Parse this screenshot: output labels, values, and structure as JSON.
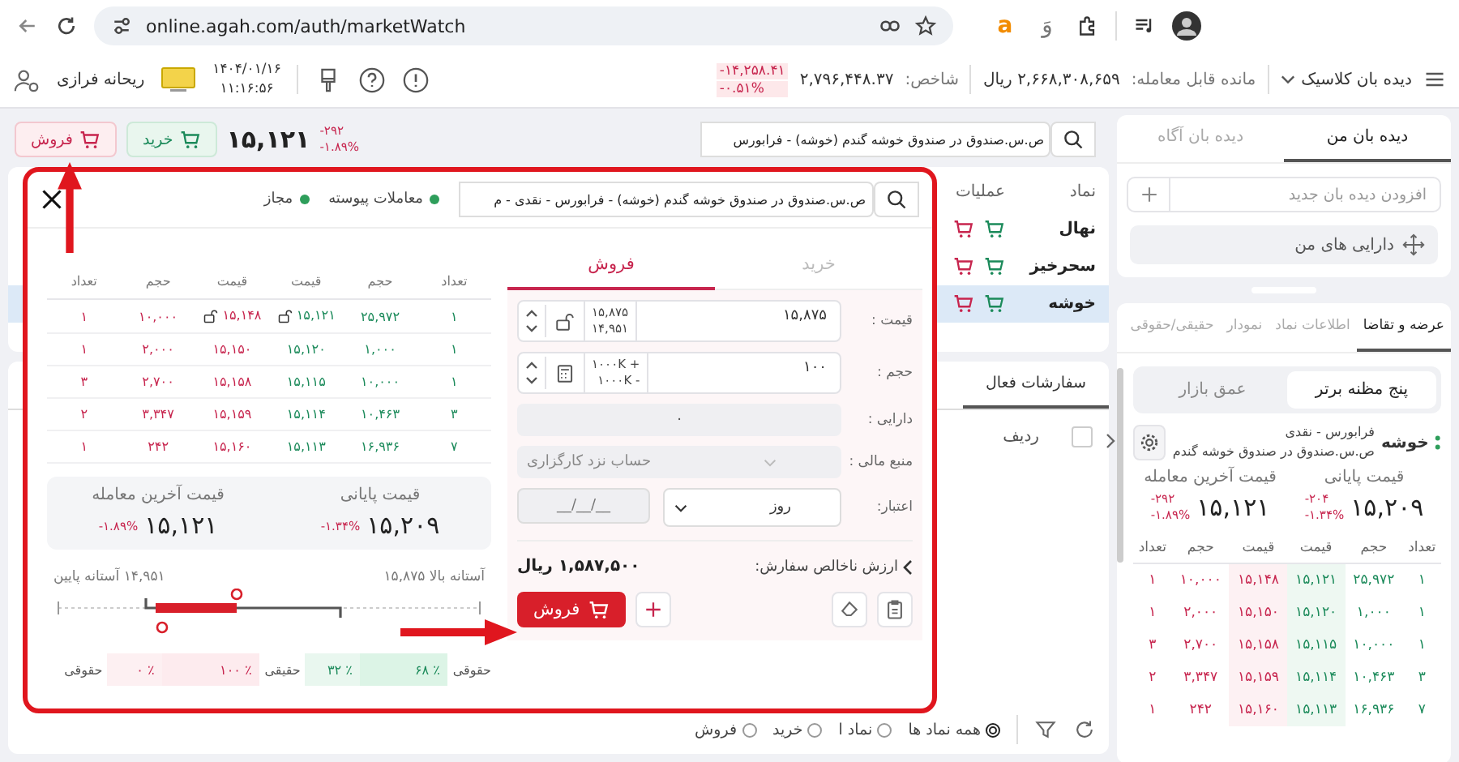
{
  "browser": {
    "url": "online.agah.com/auth/marketWatch",
    "extension_glyphs": {
      "left": "a",
      "right": "وَ"
    }
  },
  "header": {
    "menu_title": "دیده بان کلاسیک",
    "balance_label": "مانده قابل معامله:",
    "balance_value": "۲,۶۶۸,۳۰۸,۶۵۹ ریال",
    "index_label": "شاخص:",
    "index_value": "۲,۷۹۶,۴۴۸.۳۷",
    "index_change": "-۱۴,۲۵۸.۴۱",
    "index_percent": "-۰.۵۱%",
    "date": "۱۴۰۴/۰۱/۱۶",
    "time": "۱۱:۱۶:۵۶",
    "user": "ریحانه فرازی"
  },
  "symbol_bar": {
    "search_value": "ص.س.صندوق در صندوق خوشه گندم (خوشه) - فرابورس",
    "change": "-۲۹۲",
    "percent": "-۱.۸۹%",
    "price": "۱۵,۱۲۱",
    "buy_label": "خرید",
    "sell_label": "فروش"
  },
  "watchlist": {
    "columns": [
      "نماد",
      "عملیات"
    ],
    "rows": [
      {
        "symbol": "نهال",
        "selected": false
      },
      {
        "symbol": "سحرخیز",
        "selected": false
      },
      {
        "symbol": "خوشه",
        "selected": true
      }
    ]
  },
  "orders": {
    "tab": "سفارشات فعال",
    "column": "ردیف",
    "checked": false,
    "filters": [
      {
        "label": "همه نماد ها",
        "selected": true
      },
      {
        "label": "نماد ا",
        "selected": false
      },
      {
        "label": "خرید",
        "selected": false
      },
      {
        "label": "فروش",
        "selected": false
      }
    ]
  },
  "sidebar": {
    "watch_tabs": [
      {
        "label": "دیده بان من",
        "selected": true
      },
      {
        "label": "دیده بان آگاه",
        "selected": false
      }
    ],
    "new_watch_placeholder": "افزودن دیده بان جدید",
    "my_assets": "دارایی های من",
    "info_tabs": [
      {
        "label": "عرضه و تقاضا",
        "selected": true
      },
      {
        "label": "اطلاعات نماد",
        "selected": false
      },
      {
        "label": "نمودار",
        "selected": false
      },
      {
        "label": "حقیقی/حقوقی",
        "selected": false
      }
    ],
    "depth_tabs": [
      {
        "label": "پنج مظنه برتر",
        "selected": true
      },
      {
        "label": "عمق بازار",
        "selected": false
      }
    ],
    "symbol": {
      "name": "خوشه",
      "market": "فرابورس - نقدی",
      "full_name": "ص.س.صندوق در صندوق خوشه گندم"
    },
    "prices": [
      {
        "label": "قیمت پایانی",
        "value": "۱۵,۲۰۹",
        "change": "-۲۰۴",
        "percent": "-۱.۳۴%"
      },
      {
        "label": "قیمت آخرین معامله",
        "value": "۱۵,۱۲۱",
        "change": "-۲۹۲",
        "percent": "-۱.۸۹%"
      }
    ],
    "book": {
      "columns": [
        "تعداد",
        "حجم",
        "قیمت",
        "قیمت",
        "حجم",
        "تعداد"
      ],
      "rows": [
        [
          "۱",
          "۲۵,۹۷۲",
          "۱۵,۱۲۱",
          "۱۵,۱۴۸",
          "۱۰,۰۰۰",
          "۱"
        ],
        [
          "۱",
          "۱,۰۰۰",
          "۱۵,۱۲۰",
          "۱۵,۱۵۰",
          "۲,۰۰۰",
          "۱"
        ],
        [
          "۱",
          "۱۰,۰۰۰",
          "۱۵,۱۱۵",
          "۱۵,۱۵۸",
          "۲,۷۰۰",
          "۳"
        ],
        [
          "۳",
          "۱۰,۴۶۳",
          "۱۵,۱۱۴",
          "۱۵,۱۵۹",
          "۳,۳۴۷",
          "۲"
        ],
        [
          "۷",
          "۱۶,۹۳۶",
          "۱۵,۱۱۳",
          "۱۵,۱۶۰",
          "۲۴۲",
          "۱"
        ]
      ]
    }
  },
  "order_dialog": {
    "search_value": "ص.س.صندوق در صندوق خوشه گندم (خوشه) - فرابورس - نقدی - م",
    "statuses": [
      {
        "label": "معاملات پیوسته",
        "color": "#2e9e5b"
      },
      {
        "label": "مجاز",
        "color": "#2e9e5b"
      }
    ],
    "side_tabs": [
      {
        "label": "خرید",
        "selected": false
      },
      {
        "label": "فروش",
        "selected": true
      }
    ],
    "fields": [
      {
        "kind": "price",
        "label": "قیمت :",
        "value": "۱۵,۸۷۵",
        "upper": "۱۵,۸۷۵",
        "lower": "۱۴,۹۵۱"
      },
      {
        "kind": "volume",
        "label": "حجم :",
        "value": "۱۰۰",
        "upper": "+ ۱۰۰۰K",
        "lower": "- ۱۰۰۰K"
      },
      {
        "kind": "readonly",
        "label": "دارایی :",
        "value": "۰"
      },
      {
        "kind": "source",
        "label": "منبع مالی :",
        "value": "حساب نزد کارگزاری"
      },
      {
        "kind": "validity",
        "label": "اعتبار:",
        "value": "روز",
        "placeholder": "__/__/__"
      }
    ],
    "gross_label": "ارزش ناخالص سفارش:",
    "gross_value": "۱,۵۸۷,۵۰۰ ریال",
    "submit_label": "فروش",
    "book": {
      "columns": [
        "تعداد",
        "حجم",
        "قیمت",
        "قیمت",
        "حجم",
        "تعداد"
      ],
      "rows": [
        {
          "cells": [
            "۱",
            "۲۵,۹۷۲",
            "۱۵,۱۲۱",
            "۱۵,۱۴۸",
            "۱۰,۰۰۰",
            "۱"
          ],
          "locked": true
        },
        {
          "cells": [
            "۱",
            "۱,۰۰۰",
            "۱۵,۱۲۰",
            "۱۵,۱۵۰",
            "۲,۰۰۰",
            "۱"
          ],
          "locked": false
        },
        {
          "cells": [
            "۱",
            "۱۰,۰۰۰",
            "۱۵,۱۱۵",
            "۱۵,۱۵۸",
            "۲,۷۰۰",
            "۳"
          ],
          "locked": false
        },
        {
          "cells": [
            "۳",
            "۱۰,۴۶۳",
            "۱۵,۱۱۴",
            "۱۵,۱۵۹",
            "۳,۳۴۷",
            "۲"
          ],
          "locked": false
        },
        {
          "cells": [
            "۷",
            "۱۶,۹۳۶",
            "۱۵,۱۱۳",
            "۱۵,۱۶۰",
            "۲۴۲",
            "۱"
          ],
          "locked": false
        }
      ]
    },
    "summary": [
      {
        "label": "قیمت پایانی",
        "value": "۱۵,۲۰۹",
        "percent": "-۱.۳۴%"
      },
      {
        "label": "قیمت آخرین معامله",
        "value": "۱۵,۱۲۱",
        "percent": "-۱.۸۹%"
      }
    ],
    "upper_threshold": "آستانه بالا ۱۵,۸۷۵",
    "lower_threshold": "۱۴,۹۵۱ آستانه پایین",
    "ownership": [
      {
        "kind": "label",
        "text": "حقوقی"
      },
      {
        "kind": "buy",
        "cells": [
          "٪ ۶۸",
          "٪ ۳۲"
        ]
      },
      {
        "kind": "label",
        "text": "حقیقی"
      },
      {
        "kind": "sell",
        "cells": [
          "٪ ۱۰۰",
          "٪ ۰"
        ]
      },
      {
        "kind": "label",
        "text": "حقوقی"
      }
    ]
  }
}
